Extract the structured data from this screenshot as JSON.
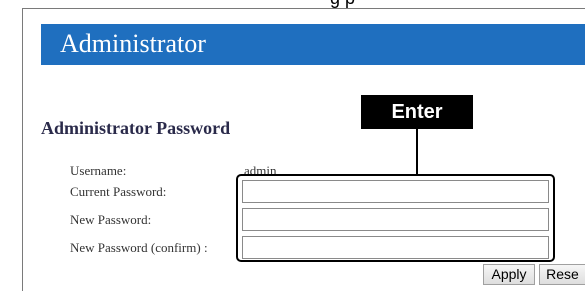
{
  "window": {
    "clipped_top_text": "g       p"
  },
  "header": {
    "title": "Administrator"
  },
  "section": {
    "heading": "Administrator Password"
  },
  "form": {
    "username_label": "Username:",
    "username_value": "admin",
    "current_password_label": "Current Password:",
    "new_password_label": "New Password:",
    "confirm_password_label": "New Password (confirm) :",
    "current_password_value": "",
    "new_password_value": "",
    "confirm_password_value": ""
  },
  "buttons": {
    "apply_label": "Apply",
    "reset_label": "Rese"
  },
  "callout": {
    "label": "Enter"
  },
  "colors": {
    "title_bar": "#1f6fbf",
    "callout": "#000000"
  }
}
